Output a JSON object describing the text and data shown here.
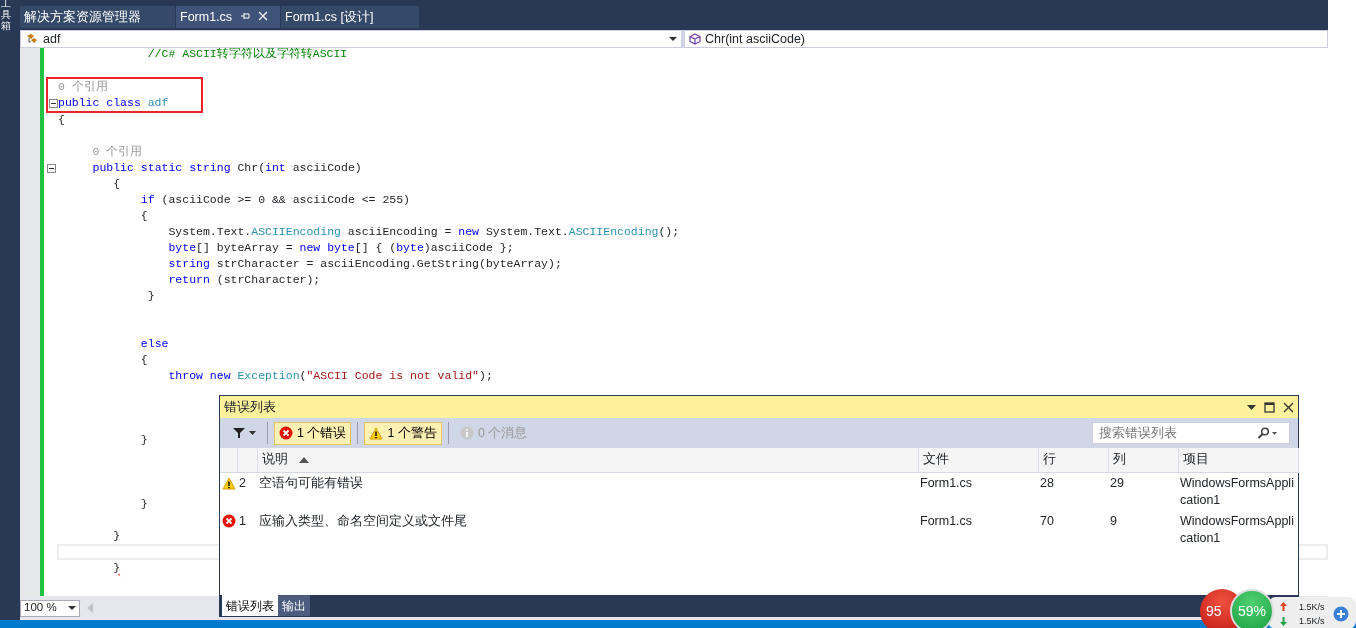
{
  "toolbox": {
    "label": "工具箱"
  },
  "tabs": [
    {
      "label": "解决方案资源管理器",
      "selected": false,
      "kind": "plain"
    },
    {
      "label": "Form1.cs",
      "selected": true,
      "kind": "closable"
    },
    {
      "label": "Form1.cs [设计]",
      "selected": false,
      "kind": "plain"
    }
  ],
  "nav_bar": {
    "type_selector": {
      "value": "adf"
    },
    "member_selector": {
      "value": "Chr(int asciiCode)"
    }
  },
  "editor": {
    "blocks": [
      {
        "boxed": false,
        "lines": [
          {
            "kind": "code",
            "tokens": [
              {
                "kind": "cm",
                "text": "             //C# ASCII转字符以及字符转ASCII"
              }
            ]
          },
          {
            "kind": "blank"
          }
        ]
      },
      {
        "boxed": true,
        "lines": [
          {
            "kind": "code",
            "tokens": [
              {
                "kind": "lens",
                "text": "0 个引用"
              }
            ]
          },
          {
            "kind": "fold",
            "tokens": [
              {
                "kind": "kw",
                "text": "public class "
              },
              {
                "kind": "ty",
                "text": "adf"
              }
            ]
          }
        ]
      },
      {
        "boxed": false,
        "lines": [
          {
            "kind": "code",
            "tokens": [
              {
                "kind": "p",
                "text": "{"
              }
            ]
          },
          {
            "kind": "blank"
          },
          {
            "kind": "code",
            "tokens": [
              {
                "kind": "lens",
                "text": "     0 个引用"
              }
            ]
          },
          {
            "kind": "fold",
            "tokens": [
              {
                "kind": "kw",
                "text": "     public static string "
              },
              {
                "kind": "p",
                "text": "Chr("
              },
              {
                "kind": "kw",
                "text": "int "
              },
              {
                "kind": "p",
                "text": "asciiCode)"
              }
            ]
          },
          {
            "kind": "code",
            "tokens": [
              {
                "kind": "p",
                "text": "        {"
              }
            ]
          },
          {
            "kind": "code",
            "tokens": [
              {
                "kind": "kw",
                "text": "            if "
              },
              {
                "kind": "p",
                "text": "(asciiCode >= 0 && asciiCode <= 255)"
              }
            ]
          },
          {
            "kind": "code",
            "tokens": [
              {
                "kind": "p",
                "text": "            {"
              }
            ]
          },
          {
            "kind": "code",
            "tokens": [
              {
                "kind": "p",
                "text": "                System.Text."
              },
              {
                "kind": "ty",
                "text": "ASCIIEncoding"
              },
              {
                "kind": "p",
                "text": " asciiEncoding = "
              },
              {
                "kind": "kw",
                "text": "new "
              },
              {
                "kind": "p",
                "text": "System.Text."
              },
              {
                "kind": "ty",
                "text": "ASCIIEncoding"
              },
              {
                "kind": "p",
                "text": "();"
              }
            ]
          },
          {
            "kind": "code",
            "tokens": [
              {
                "kind": "kw",
                "text": "                byte"
              },
              {
                "kind": "p",
                "text": "[] byteArray = "
              },
              {
                "kind": "kw",
                "text": "new byte"
              },
              {
                "kind": "p",
                "text": "[] { ("
              },
              {
                "kind": "kw",
                "text": "byte"
              },
              {
                "kind": "p",
                "text": ")asciiCode };"
              }
            ]
          },
          {
            "kind": "code",
            "tokens": [
              {
                "kind": "kw",
                "text": "                string "
              },
              {
                "kind": "p",
                "text": "strCharacter = asciiEncoding.GetString(byteArray);"
              }
            ]
          },
          {
            "kind": "code",
            "tokens": [
              {
                "kind": "kw",
                "text": "                return "
              },
              {
                "kind": "p",
                "text": "(strCharacter);"
              }
            ]
          },
          {
            "kind": "code",
            "tokens": [
              {
                "kind": "p",
                "text": "             }"
              }
            ]
          },
          {
            "kind": "blank"
          },
          {
            "kind": "blank"
          },
          {
            "kind": "code",
            "tokens": [
              {
                "kind": "kw",
                "text": "            else"
              }
            ]
          },
          {
            "kind": "code",
            "tokens": [
              {
                "kind": "p",
                "text": "            {"
              }
            ]
          },
          {
            "kind": "code",
            "tokens": [
              {
                "kind": "kw",
                "text": "                throw new "
              },
              {
                "kind": "ty",
                "text": "Exception"
              },
              {
                "kind": "p",
                "text": "("
              },
              {
                "kind": "st",
                "text": "\"ASCII Code is not valid\""
              },
              {
                "kind": "p",
                "text": ");"
              }
            ]
          },
          {
            "kind": "blank"
          },
          {
            "kind": "blank"
          },
          {
            "kind": "blank"
          },
          {
            "kind": "code",
            "tokens": [
              {
                "kind": "p",
                "text": "            }"
              }
            ]
          },
          {
            "kind": "blank"
          },
          {
            "kind": "blank"
          },
          {
            "kind": "blank"
          },
          {
            "kind": "code",
            "tokens": [
              {
                "kind": "p",
                "text": "            }"
              }
            ]
          },
          {
            "kind": "blank"
          },
          {
            "kind": "code",
            "tokens": [
              {
                "kind": "p",
                "text": "        }"
              }
            ]
          },
          {
            "kind": "current"
          },
          {
            "kind": "code",
            "tokens": [
              {
                "kind": "err",
                "text": "        }"
              }
            ]
          }
        ]
      }
    ]
  },
  "zoom": {
    "value": "100 %"
  },
  "error_list": {
    "title": "错误列表",
    "filters": [
      {
        "kind": "error",
        "label": "1 个错误",
        "selected": true
      },
      {
        "kind": "warning",
        "label": "1 个警告",
        "selected": true
      },
      {
        "kind": "info",
        "label": "0 个消息",
        "selected": false
      }
    ],
    "search": {
      "placeholder": "搜索错误列表"
    },
    "columns": [
      {
        "label": "说明",
        "sorted": true
      },
      {
        "label": "文件",
        "sorted": false
      },
      {
        "label": "行",
        "sorted": false
      },
      {
        "label": "列",
        "sorted": false
      },
      {
        "label": "项目",
        "sorted": false
      }
    ],
    "rows": [
      {
        "kind": "warning",
        "number": "2",
        "description": "空语句可能有错误",
        "file": "Form1.cs",
        "line": "28",
        "column": "29",
        "project": "WindowsFormsApplication1"
      },
      {
        "kind": "error",
        "number": "1",
        "description": "应输入类型、命名空间定义或文件尾",
        "file": "Form1.cs",
        "line": "70",
        "column": "9",
        "project": "WindowsFormsApplication1"
      }
    ],
    "bottom_tabs": [
      {
        "label": "错误列表",
        "selected": true
      },
      {
        "label": "输出",
        "selected": false
      }
    ]
  },
  "tray": {
    "cpu": "95",
    "memory": "59%",
    "upload": "1.5K/s",
    "download": "1.5K/s"
  }
}
